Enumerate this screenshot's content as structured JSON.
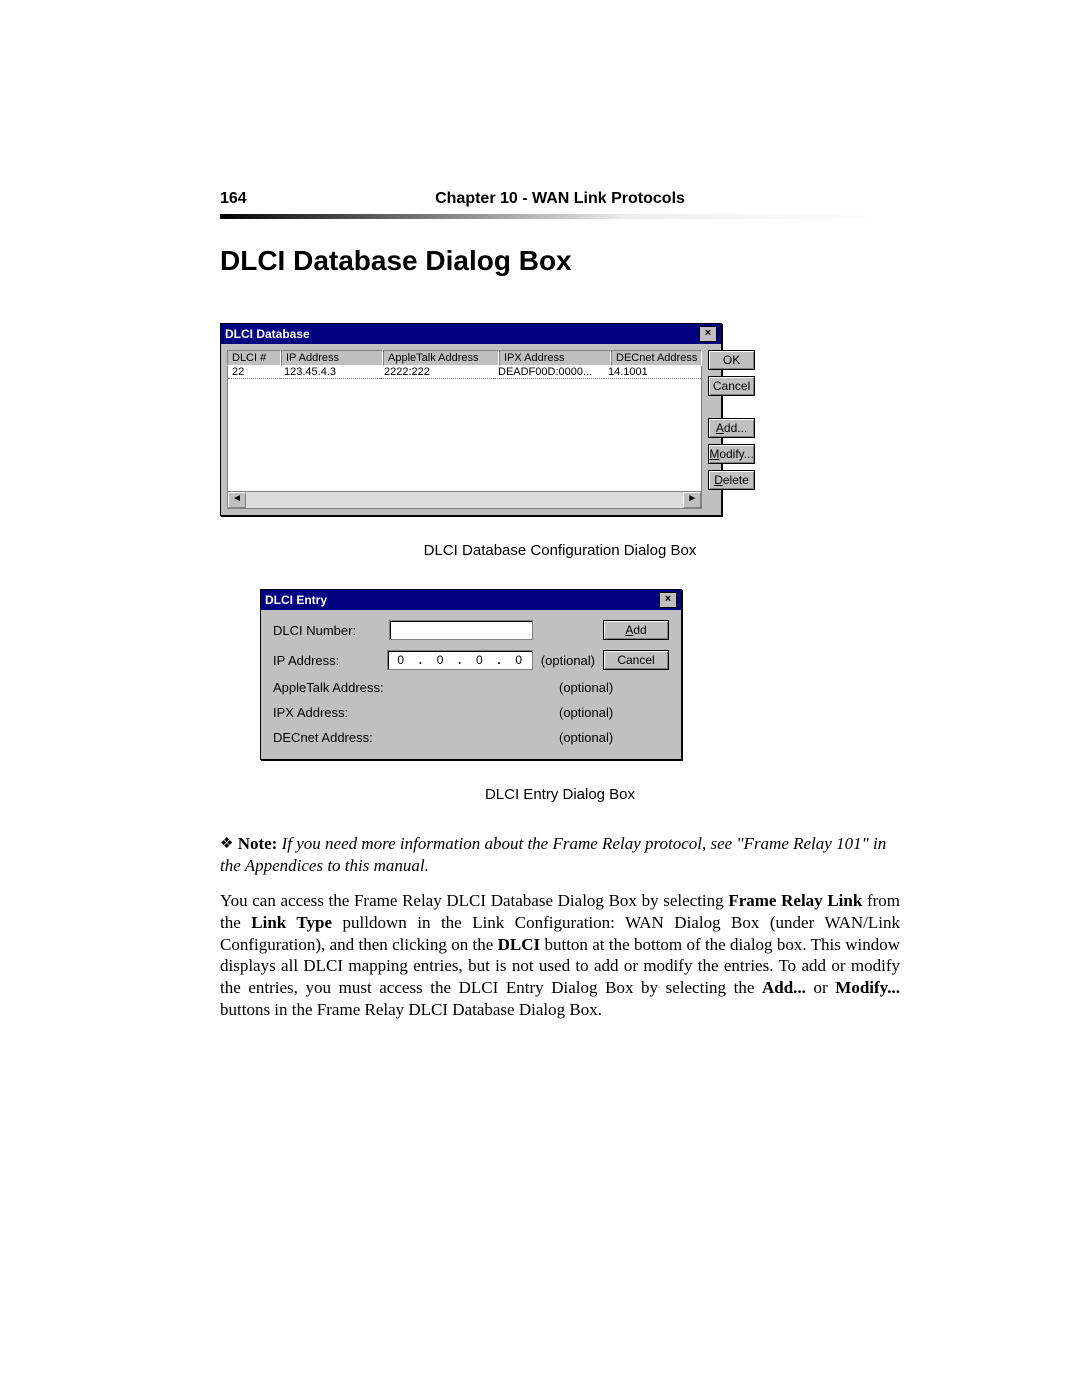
{
  "header": {
    "page_number": "164",
    "chapter_title": "Chapter 10 - WAN Link Protocols"
  },
  "section_title": "DLCI Database Dialog Box",
  "dlci_db": {
    "window_title": "DLCI Database",
    "columns": {
      "dlci": "DLCI #",
      "ip": "IP Address",
      "at": "AppleTalk Address",
      "ipx": "IPX Address",
      "dec": "DECnet Address"
    },
    "rows": [
      {
        "dlci": "22",
        "ip": "123.45.4.3",
        "at": "2222:222",
        "ipx": "DEADF00D:0000...",
        "dec": "14.1001"
      }
    ],
    "buttons": {
      "ok": "OK",
      "cancel": "Cancel",
      "add": "dd...",
      "add_u": "A",
      "modify": "odify...",
      "modify_u": "M",
      "delete": "elete",
      "delete_u": "D"
    }
  },
  "fig1_caption": "DLCI Database Configuration Dialog Box",
  "dlci_entry": {
    "window_title": "DLCI Entry",
    "labels": {
      "dlci_num": "DLCI Number:",
      "ip": "IP Address:",
      "at": "AppleTalk Address:",
      "ipx": "IPX Address:",
      "dec": "DECnet Address:"
    },
    "ip_octets": [
      "0",
      "0",
      "0",
      "0"
    ],
    "optional": "(optional)",
    "buttons": {
      "add_u": "A",
      "add": "dd",
      "cancel": "Cancel"
    }
  },
  "fig2_caption": "DLCI Entry Dialog Box",
  "note_text_pre": "If you need more information about the Frame Relay protocol, see \"Frame Relay 101\" in the Appendices to this manual.",
  "note_label": "Note:",
  "body_text": {
    "p1a": "You can access the Frame Relay DLCI Database Dialog Box by selecting ",
    "b1": "Frame Relay Link",
    "p1b": " from the ",
    "b2": "Link Type",
    "p1c": " pulldown in the Link Configuration: WAN Dialog Box (under WAN/Link Configuration), and then clicking on the ",
    "b3": "DLCI",
    "p1d": " button at the bottom of the dialog box. This window displays all DLCI mapping entries, but is not used to add or modify the entries. To add or modify the entries, you must access the DLCI Entry Dialog Box by selecting the ",
    "b4": "Add...",
    "p1e": " or ",
    "b5": "Modify...",
    "p1f": " buttons in the Frame Relay DLCI Database Dialog Box."
  }
}
